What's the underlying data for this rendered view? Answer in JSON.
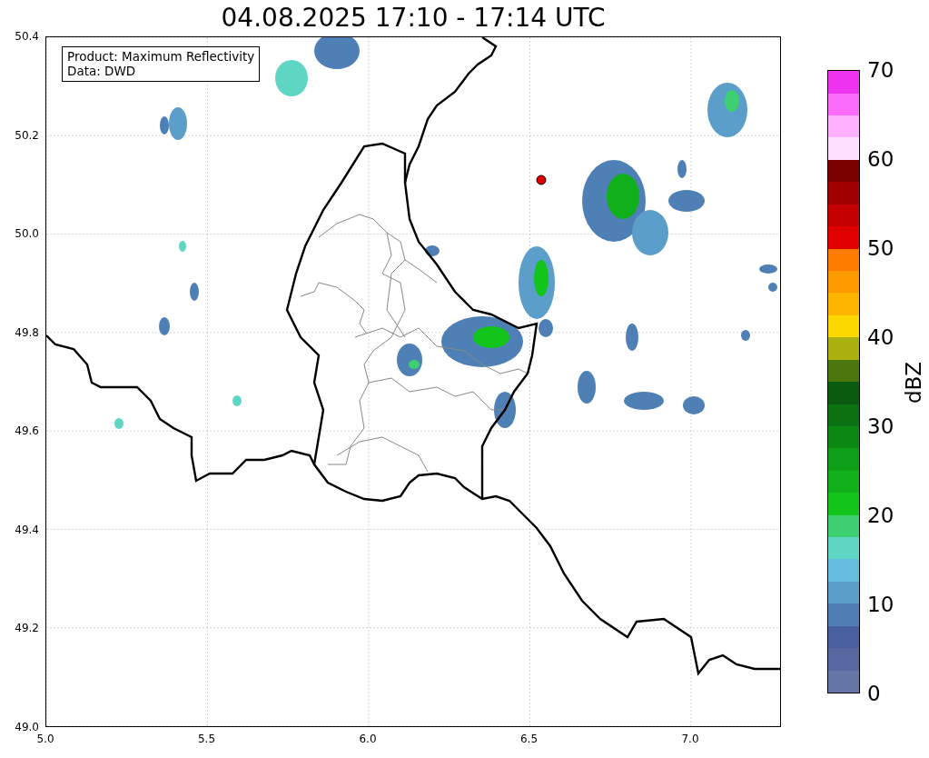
{
  "title": "04.08.2025 17:10 - 17:14 UTC",
  "legend": {
    "lines": [
      "Product: Maximum Reflectivity",
      "Data: DWD"
    ]
  },
  "x_ticks": [
    "5.0",
    "5.5",
    "6.0",
    "6.5",
    "7.0"
  ],
  "y_ticks": [
    "50.4",
    "50.2",
    "50.0",
    "49.8",
    "49.6",
    "49.4",
    "49.2",
    "49.0"
  ],
  "colorbar": {
    "label": "dBZ",
    "ticks": [
      "70",
      "60",
      "50",
      "40",
      "30",
      "20",
      "10",
      "0"
    ],
    "bands": [
      {
        "color": "#6577a6"
      },
      {
        "color": "#56689f"
      },
      {
        "color": "#4a5f9f"
      },
      {
        "color": "#4e80b5"
      },
      {
        "color": "#5a9ec9"
      },
      {
        "color": "#66bde0"
      },
      {
        "color": "#5fd6c4"
      },
      {
        "color": "#3ecf70"
      },
      {
        "color": "#13c41a"
      },
      {
        "color": "#10b01b"
      },
      {
        "color": "#0e9f17"
      },
      {
        "color": "#0b8812"
      },
      {
        "color": "#0b7212"
      },
      {
        "color": "#0a5a10"
      },
      {
        "color": "#4a780f"
      },
      {
        "color": "#aab10e"
      },
      {
        "color": "#fdd700"
      },
      {
        "color": "#fdb500"
      },
      {
        "color": "#fd9a00"
      },
      {
        "color": "#fd7c00"
      },
      {
        "color": "#e00000"
      },
      {
        "color": "#c40000"
      },
      {
        "color": "#a00000"
      },
      {
        "color": "#7a0000"
      },
      {
        "color": "#ffe0ff"
      },
      {
        "color": "#ffb0ff"
      },
      {
        "color": "#fb6cfb"
      },
      {
        "color": "#ee33ee"
      }
    ]
  }
}
